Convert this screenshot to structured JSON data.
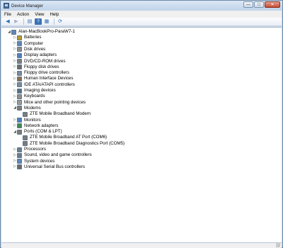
{
  "window": {
    "title": "Device Manager"
  },
  "title_buttons": {
    "minimize": "—",
    "maximize": "□",
    "close": "✕"
  },
  "menu": [
    "File",
    "Action",
    "View",
    "Help"
  ],
  "toolbar": [
    "back-icon",
    "forward-icon",
    "properties-icon",
    "help-icon",
    "device-view-icon",
    "scan-icon"
  ],
  "tree": {
    "root": "Alan-MacBookPro-ParaW7-1",
    "items": [
      {
        "label": "Batteries",
        "level": 1,
        "expander": "▷",
        "icon": "battery-icon",
        "color": "#b79a2b"
      },
      {
        "label": "Computer",
        "level": 1,
        "expander": "▷",
        "icon": "computer-icon",
        "color": "#5f86b5"
      },
      {
        "label": "Disk drives",
        "level": 1,
        "expander": "▷",
        "icon": "disk-drive-icon",
        "color": "#8d8d8d"
      },
      {
        "label": "Display adapters",
        "level": 1,
        "expander": "▷",
        "icon": "display-adapter-icon",
        "color": "#4f7fbf"
      },
      {
        "label": "DVD/CD-ROM drives",
        "level": 1,
        "expander": "▷",
        "icon": "dvd-drive-icon",
        "color": "#7d7d7d"
      },
      {
        "label": "Floppy disk drives",
        "level": 1,
        "expander": "▷",
        "icon": "floppy-icon",
        "color": "#6b6b6b"
      },
      {
        "label": "Floppy drive controllers",
        "level": 1,
        "expander": "▷",
        "icon": "controller-icon",
        "color": "#7a8a9a"
      },
      {
        "label": "Human Interface Devices",
        "level": 1,
        "expander": "▷",
        "icon": "hid-icon",
        "color": "#8a6f4e"
      },
      {
        "label": "IDE ATA/ATAPI controllers",
        "level": 1,
        "expander": "▷",
        "icon": "ide-icon",
        "color": "#7a8a9a"
      },
      {
        "label": "Imaging devices",
        "level": 1,
        "expander": "▷",
        "icon": "camera-icon",
        "color": "#5b6f82"
      },
      {
        "label": "Keyboards",
        "level": 1,
        "expander": "▷",
        "icon": "keyboard-icon",
        "color": "#8f8f8f"
      },
      {
        "label": "Mice and other pointing devices",
        "level": 1,
        "expander": "▷",
        "icon": "mouse-icon",
        "color": "#9a9a9a"
      },
      {
        "label": "Modems",
        "level": 1,
        "expander": "◢",
        "icon": "modem-icon",
        "color": "#7c7c7c"
      },
      {
        "label": "ZTE Mobile Broadband Modem",
        "level": 2,
        "expander": "",
        "icon": "modem-icon",
        "color": "#7c7c7c"
      },
      {
        "label": "Monitors",
        "level": 1,
        "expander": "▷",
        "icon": "monitor-icon",
        "color": "#4f7fbf"
      },
      {
        "label": "Network adapters",
        "level": 1,
        "expander": "▷",
        "icon": "network-icon",
        "color": "#3f8a4f"
      },
      {
        "label": "Ports (COM & LPT)",
        "level": 1,
        "expander": "◢",
        "icon": "port-icon",
        "color": "#7b7b7b"
      },
      {
        "label": "ZTE Mobile Broadband AT Port (COM6)",
        "level": 2,
        "expander": "",
        "icon": "port-icon",
        "color": "#7b7b7b"
      },
      {
        "label": "ZTE Mobile Broadband Diagnostics Port (COM5)",
        "level": 2,
        "expander": "",
        "icon": "port-icon",
        "color": "#7b7b7b"
      },
      {
        "label": "Processors",
        "level": 1,
        "expander": "▷",
        "icon": "processor-icon",
        "color": "#6a7f8f"
      },
      {
        "label": "Sound, video and game controllers",
        "level": 1,
        "expander": "▷",
        "icon": "sound-icon",
        "color": "#6b7b8b"
      },
      {
        "label": "System devices",
        "level": 1,
        "expander": "▷",
        "icon": "system-device-icon",
        "color": "#5f86b5"
      },
      {
        "label": "Universal Serial Bus controllers",
        "level": 1,
        "expander": "▷",
        "icon": "usb-icon",
        "color": "#6b6b6b"
      }
    ]
  }
}
